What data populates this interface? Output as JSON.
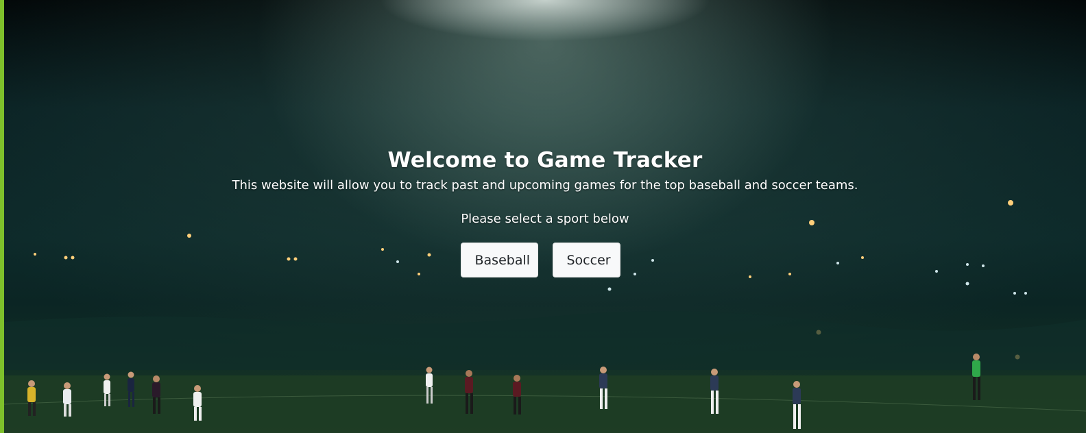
{
  "hero": {
    "title": "Welcome to Game Tracker",
    "subtitle": "This website will allow you to track past and upcoming games for the top baseball and soccer teams.",
    "prompt": "Please select a sport below"
  },
  "sports": {
    "baseball_label": "Baseball",
    "soccer_label": "Soccer"
  },
  "colors": {
    "accent_bar": "#7ec02b",
    "button_bg": "#f8f9fa",
    "text": "#ffffff"
  }
}
